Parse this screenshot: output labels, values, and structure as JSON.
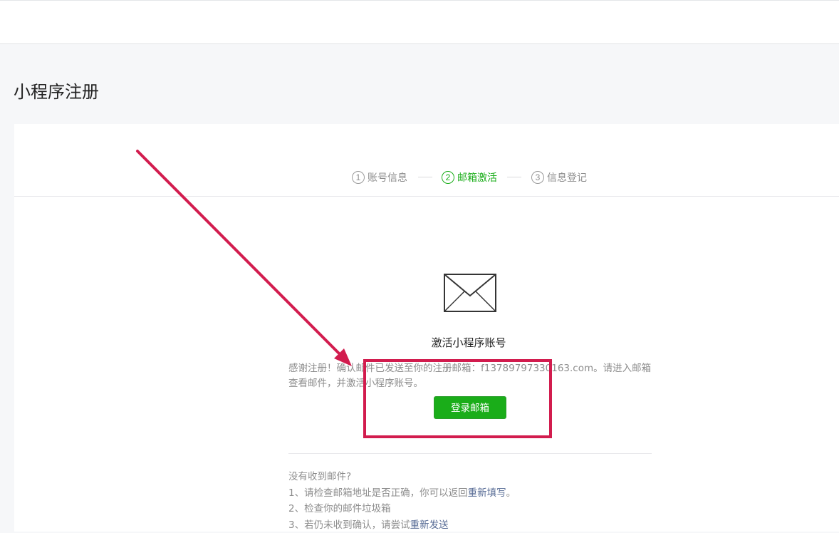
{
  "page": {
    "title": "小程序注册"
  },
  "steps": [
    {
      "number": "1",
      "label": "账号信息",
      "active": false
    },
    {
      "number": "2",
      "label": "邮箱激活",
      "active": true
    },
    {
      "number": "3",
      "label": "信息登记",
      "active": false
    }
  ],
  "activation": {
    "icon": "envelope-icon",
    "heading": "激活小程序账号",
    "description": "感谢注册！确认邮件已发送至你的注册邮箱：f13789797330163.com。请进入邮箱查看邮件，并激活小程序账号。",
    "login_button": "登录邮箱"
  },
  "help": {
    "title": "没有收到邮件?",
    "tip1_prefix": "1、请检查邮箱地址是否正确，你可以返回",
    "tip1_link": "重新填写",
    "tip1_suffix": "。",
    "tip2": "2、检查你的邮件垃圾箱",
    "tip3_prefix": "3、若仍未收到确认，请尝试",
    "tip3_link": "重新发送"
  },
  "colors": {
    "accent_green": "#1aad19",
    "link_blue": "#576b95",
    "annotation_red": "#d21c4e"
  }
}
